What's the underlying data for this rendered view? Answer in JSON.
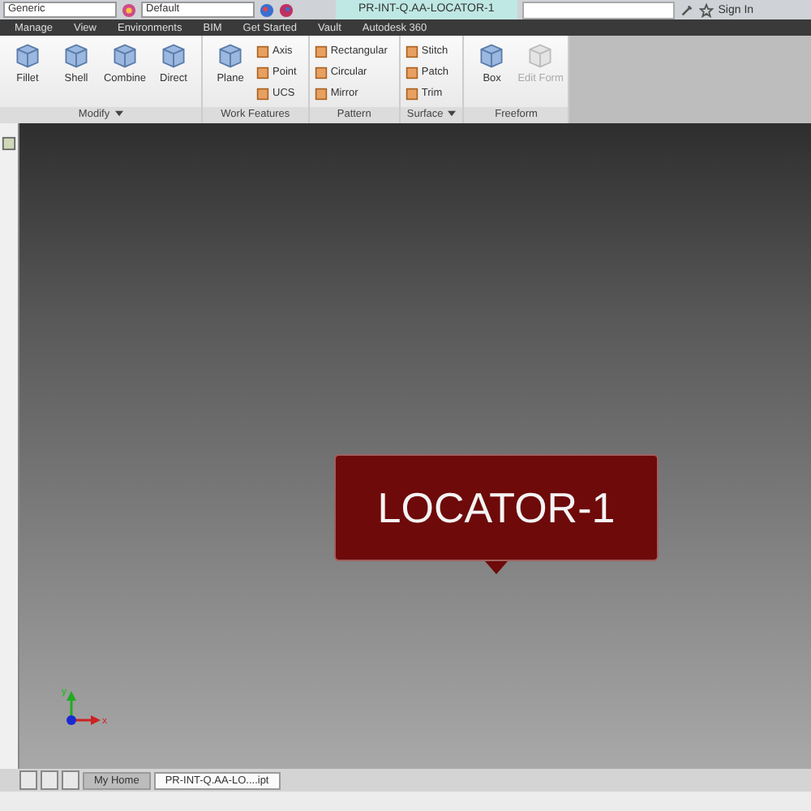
{
  "quick_access": {
    "material": "Generic",
    "appearance": "Default",
    "title": "PR-INT-Q.AA-LOCATOR-1",
    "sign_in": "Sign In"
  },
  "menu_tabs": [
    {
      "label": "Manage",
      "selected": false
    },
    {
      "label": "View",
      "selected": false
    },
    {
      "label": "Environments",
      "selected": false
    },
    {
      "label": "BIM",
      "selected": false
    },
    {
      "label": "Get Started",
      "selected": false
    },
    {
      "label": "Vault",
      "selected": false
    },
    {
      "label": "Autodesk 360",
      "selected": false
    }
  ],
  "panels": [
    {
      "label": "Modify",
      "has_menu": true,
      "tools": [
        {
          "kind": "large",
          "label": "Fillet",
          "disabled": false
        },
        {
          "kind": "large",
          "label": "Shell",
          "disabled": false
        },
        {
          "kind": "large",
          "label": "Combine",
          "disabled": false
        },
        {
          "kind": "large",
          "label": "Direct",
          "disabled": false
        }
      ]
    },
    {
      "label": "Work Features",
      "has_menu": false,
      "tools": [
        {
          "kind": "large",
          "label": "Plane",
          "disabled": false
        },
        {
          "kind": "small",
          "label": "Axis",
          "disabled": false
        },
        {
          "kind": "small",
          "label": "Point",
          "disabled": false
        },
        {
          "kind": "small",
          "label": "UCS",
          "disabled": false
        }
      ]
    },
    {
      "label": "Pattern",
      "has_menu": false,
      "tools": [
        {
          "kind": "small",
          "label": "Rectangular",
          "disabled": false
        },
        {
          "kind": "small",
          "label": "Circular",
          "disabled": false
        },
        {
          "kind": "small",
          "label": "Mirror",
          "disabled": false
        }
      ]
    },
    {
      "label": "Surface",
      "has_menu": true,
      "tools": [
        {
          "kind": "small",
          "label": "Stitch",
          "disabled": false
        },
        {
          "kind": "small",
          "label": "Patch",
          "disabled": false
        },
        {
          "kind": "small",
          "label": "Trim",
          "disabled": false
        }
      ]
    },
    {
      "label": "Freeform",
      "has_menu": false,
      "tools": [
        {
          "kind": "large",
          "label": "Box",
          "disabled": false
        },
        {
          "kind": "large",
          "label": "Edit Form",
          "disabled": true
        }
      ]
    }
  ],
  "tooltip": {
    "text": "LOCATOR-1"
  },
  "triad": {
    "x_label": "x",
    "y_label": "y"
  },
  "doc_tabs": [
    {
      "label": "My Home",
      "selected": false
    },
    {
      "label": "PR-INT-Q.AA-LO....ipt",
      "selected": true
    }
  ]
}
